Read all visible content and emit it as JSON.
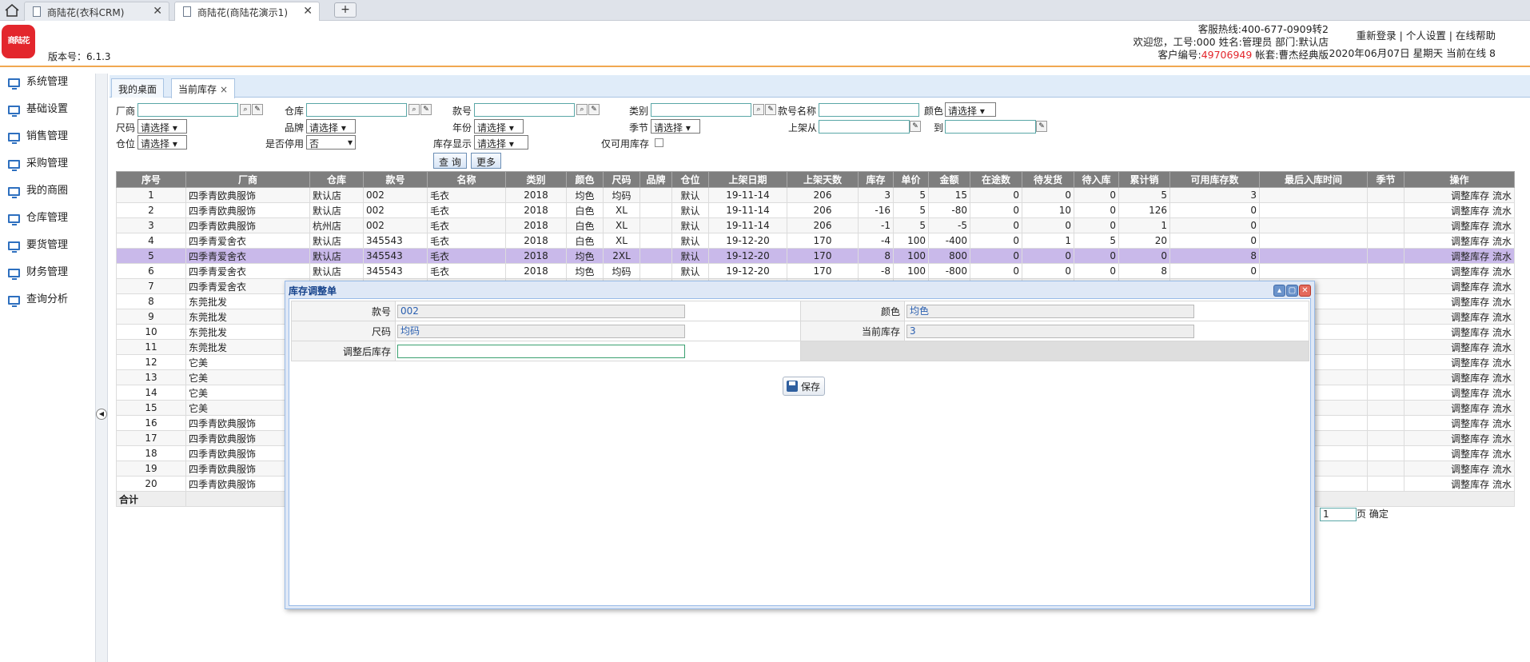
{
  "browser": {
    "tabs": [
      {
        "title": "商陆花(衣科CRM)",
        "close": "✕"
      },
      {
        "title": "商陆花(商陆花演示1)",
        "close": "✕"
      }
    ],
    "new_tab": "+"
  },
  "header": {
    "logo_text": "商陆花",
    "version": "版本号：6.1.3",
    "hotline": "客服热线:400-677-0909转2",
    "welcome": "欢迎您，工号:000 姓名:管理员 部门:默认店",
    "customer_label": "客户编号:",
    "customer_no": "49706949",
    "account": " 帐套:曹杰经典版",
    "links": "重新登录 | 个人设置 | 在线帮助",
    "datetime": "2020年06月07日 星期天 当前在线 8"
  },
  "sidebar": {
    "items": [
      "系统管理",
      "基础设置",
      "销售管理",
      "采购管理",
      "我的商圈",
      "仓库管理",
      "要货管理",
      "财务管理",
      "查询分析"
    ]
  },
  "content_tabs": {
    "desk": "我的桌面",
    "current": "当前库存",
    "close": "×"
  },
  "filters": {
    "factory": "厂商",
    "warehouse": "仓库",
    "style_no": "款号",
    "category": "类别",
    "style_name": "款号名称",
    "color": "颜色",
    "size": "尺码",
    "brand": "品牌",
    "year": "年份",
    "season": "季节",
    "on_shelf_from": "上架从",
    "to": "到",
    "location": "仓位",
    "disabled": "是否停用",
    "stock_display": "库存显示",
    "available_only": "仅可用库存",
    "select_placeholder": "请选择",
    "disabled_value": "否",
    "query_btn": "查 询",
    "more_btn": "更多"
  },
  "table": {
    "columns": [
      "序号",
      "厂商",
      "仓库",
      "款号",
      "名称",
      "类别",
      "颜色",
      "尺码",
      "品牌",
      "仓位",
      "上架日期",
      "上架天数",
      "库存",
      "单价",
      "金额",
      "在途数",
      "待发货",
      "待入库",
      "累计销",
      "可用库存数",
      "最后入库时间",
      "季节",
      "操作"
    ],
    "rows": [
      [
        "1",
        "四季青欧典服饰",
        "默认店",
        "002",
        "毛衣",
        "2018",
        "均色",
        "均码",
        "",
        "默认",
        "19-11-14",
        "206",
        "3",
        "5",
        "15",
        "0",
        "0",
        "0",
        "5",
        "3",
        "",
        ""
      ],
      [
        "2",
        "四季青欧典服饰",
        "默认店",
        "002",
        "毛衣",
        "2018",
        "白色",
        "XL",
        "",
        "默认",
        "19-11-14",
        "206",
        "-16",
        "5",
        "-80",
        "0",
        "10",
        "0",
        "126",
        "0",
        "",
        ""
      ],
      [
        "3",
        "四季青欧典服饰",
        "杭州店",
        "002",
        "毛衣",
        "2018",
        "白色",
        "XL",
        "",
        "默认",
        "19-11-14",
        "206",
        "-1",
        "5",
        "-5",
        "0",
        "0",
        "0",
        "1",
        "0",
        "",
        ""
      ],
      [
        "4",
        "四季青爱舍衣",
        "默认店",
        "345543",
        "毛衣",
        "2018",
        "白色",
        "XL",
        "",
        "默认",
        "19-12-20",
        "170",
        "-4",
        "100",
        "-400",
        "0",
        "1",
        "5",
        "20",
        "0",
        "",
        ""
      ],
      [
        "5",
        "四季青爱舍衣",
        "默认店",
        "345543",
        "毛衣",
        "2018",
        "均色",
        "2XL",
        "",
        "默认",
        "19-12-20",
        "170",
        "8",
        "100",
        "800",
        "0",
        "0",
        "0",
        "0",
        "8",
        "",
        ""
      ],
      [
        "6",
        "四季青爱舍衣",
        "默认店",
        "345543",
        "毛衣",
        "2018",
        "均色",
        "均码",
        "",
        "默认",
        "19-12-20",
        "170",
        "-8",
        "100",
        "-800",
        "0",
        "0",
        "0",
        "8",
        "0",
        "",
        ""
      ],
      [
        "7",
        "四季青爱舍衣",
        "",
        "",
        "",
        "",
        "",
        "",
        "",
        "",
        "",
        "",
        "",
        "",
        "",
        "",
        "",
        "",
        "",
        "",
        "",
        ""
      ],
      [
        "8",
        "东莞批发",
        "",
        "",
        "",
        "",
        "",
        "",
        "",
        "",
        "",
        "",
        "",
        "",
        "",
        "",
        "",
        "",
        "",
        "",
        "",
        ""
      ],
      [
        "9",
        "东莞批发",
        "",
        "",
        "",
        "",
        "",
        "",
        "",
        "",
        "",
        "",
        "",
        "",
        "",
        "",
        "",
        "",
        "",
        "",
        "",
        ""
      ],
      [
        "10",
        "东莞批发",
        "",
        "",
        "",
        "",
        "",
        "",
        "",
        "",
        "",
        "",
        "",
        "",
        "",
        "",
        "",
        "",
        "",
        "",
        "",
        ""
      ],
      [
        "11",
        "东莞批发",
        "",
        "",
        "",
        "",
        "",
        "",
        "",
        "",
        "",
        "",
        "",
        "",
        "",
        "",
        "",
        "",
        "",
        "",
        "",
        ""
      ],
      [
        "12",
        "它美",
        "",
        "",
        "",
        "",
        "",
        "",
        "",
        "",
        "",
        "",
        "",
        "",
        "",
        "",
        "",
        "",
        "",
        "",
        "",
        ""
      ],
      [
        "13",
        "它美",
        "",
        "",
        "",
        "",
        "",
        "",
        "",
        "",
        "",
        "",
        "",
        "",
        "",
        "",
        "",
        "",
        "",
        "",
        "",
        ""
      ],
      [
        "14",
        "它美",
        "",
        "",
        "",
        "",
        "",
        "",
        "",
        "",
        "",
        "",
        "",
        "",
        "",
        "",
        "",
        "",
        "",
        "",
        "",
        ""
      ],
      [
        "15",
        "它美",
        "",
        "",
        "",
        "",
        "",
        "",
        "",
        "",
        "",
        "",
        "",
        "",
        "",
        "",
        "",
        "",
        "",
        "",
        "",
        ""
      ],
      [
        "16",
        "四季青欧典服饰",
        "",
        "",
        "",
        "",
        "",
        "",
        "",
        "",
        "",
        "",
        "",
        "",
        "",
        "",
        "",
        "",
        "",
        "",
        "",
        ""
      ],
      [
        "17",
        "四季青欧典服饰",
        "",
        "",
        "",
        "",
        "",
        "",
        "",
        "",
        "",
        "",
        "",
        "",
        "",
        "",
        "",
        "",
        "",
        "",
        "",
        ""
      ],
      [
        "18",
        "四季青欧典服饰",
        "",
        "",
        "",
        "",
        "",
        "",
        "",
        "",
        "",
        "",
        "",
        "",
        "",
        "",
        "",
        "",
        "",
        "",
        "",
        ""
      ],
      [
        "19",
        "四季青欧典服饰",
        "",
        "",
        "",
        "",
        "",
        "",
        "",
        "",
        "",
        "",
        "",
        "",
        "",
        "",
        "",
        "",
        "",
        "",
        "",
        ""
      ],
      [
        "20",
        "四季青欧典服饰",
        "",
        "",
        "",
        "",
        "",
        "",
        "",
        "",
        "",
        "",
        "",
        "",
        "",
        "",
        "",
        "",
        "",
        "",
        "",
        ""
      ]
    ],
    "selected_row": 5,
    "action_adjust": "调整库存",
    "action_flow": "流水",
    "total_label": "合计",
    "selected_color": "#c9b9ea"
  },
  "pager": {
    "page_value": "1",
    "page_suffix": "页",
    "confirm": "确定"
  },
  "dialog": {
    "title": "库存调整单",
    "style_label": "款号",
    "style_value": "002",
    "color_label": "颜色",
    "color_value": "均色",
    "size_label": "尺码",
    "size_value": "均码",
    "stock_label": "当前库存",
    "stock_value": "3",
    "adjusted_label": "调整后库存",
    "save": "保存",
    "tool_collapse": "▴",
    "tool_max": "▢",
    "tool_close": "✕"
  }
}
